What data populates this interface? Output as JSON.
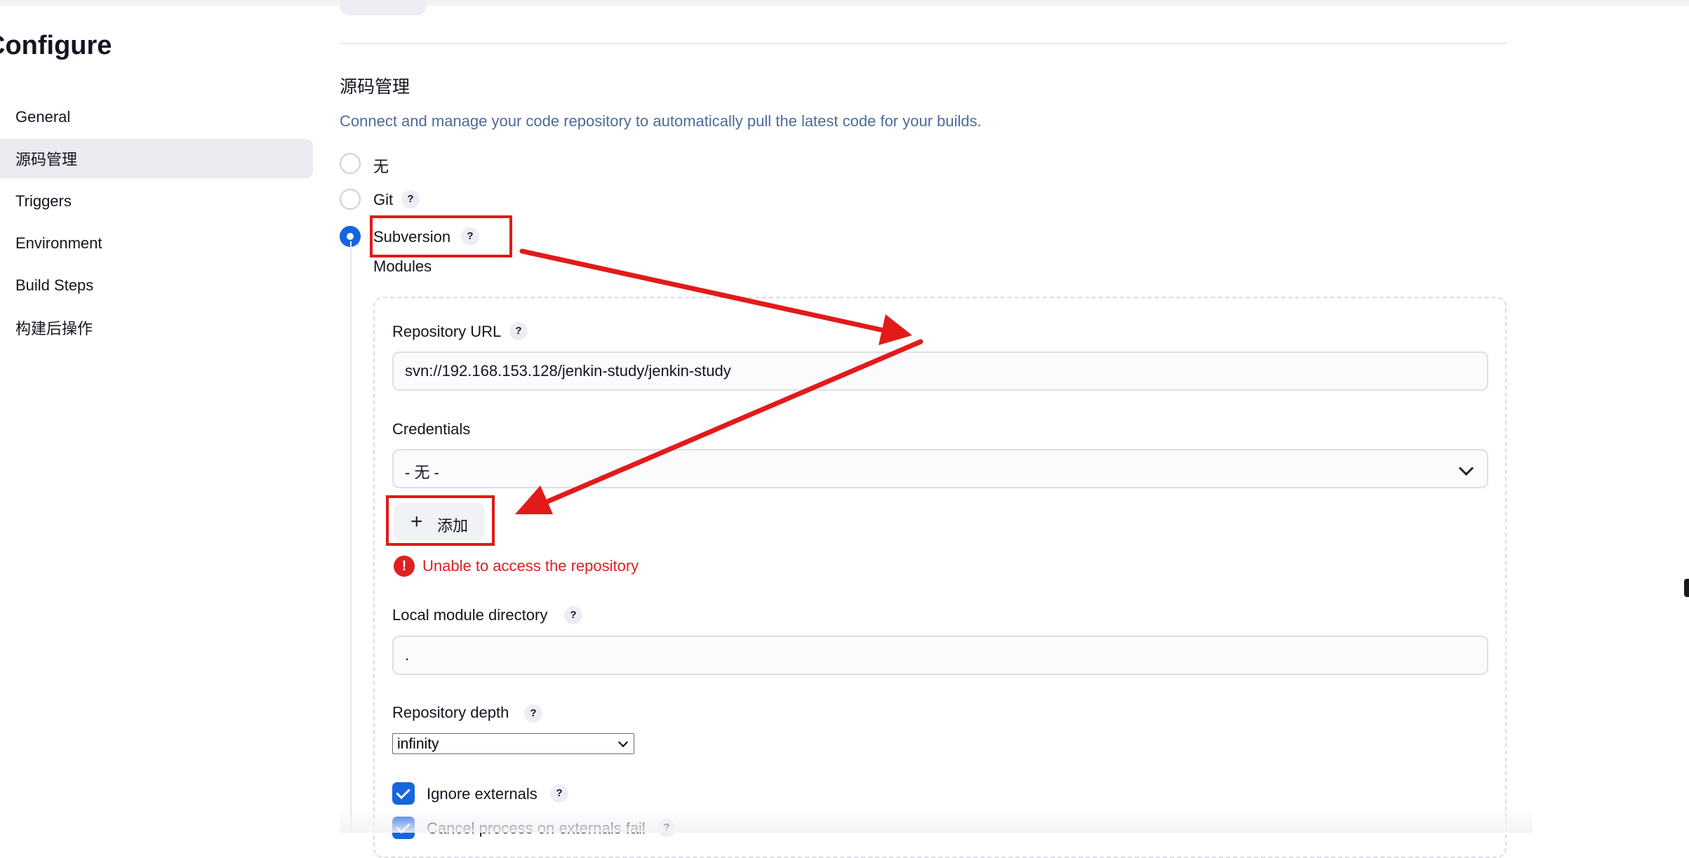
{
  "page": {
    "title": "Configure"
  },
  "sidebar": {
    "items": [
      {
        "label": "General",
        "active": false
      },
      {
        "label": "源码管理",
        "active": true
      },
      {
        "label": "Triggers",
        "active": false
      },
      {
        "label": "Environment",
        "active": false
      },
      {
        "label": "Build Steps",
        "active": false
      },
      {
        "label": "构建后操作",
        "active": false
      }
    ]
  },
  "scm": {
    "title": "源码管理",
    "description": "Connect and manage your code repository to automatically pull the latest code for your builds.",
    "options": [
      {
        "label": "无",
        "selected": false
      },
      {
        "label": "Git",
        "selected": false
      },
      {
        "label": "Subversion",
        "selected": true
      }
    ],
    "help_glyph": "?",
    "modules_label": "Modules",
    "repository_url": {
      "label": "Repository URL",
      "value": "svn://192.168.153.128/jenkin-study/jenkin-study"
    },
    "credentials": {
      "label": "Credentials",
      "value": "- 无 -"
    },
    "add_button": {
      "icon": "+",
      "label": "添加"
    },
    "error": {
      "icon": "!",
      "message": "Unable to access the repository"
    },
    "local_module_directory": {
      "label": "Local module directory",
      "value": "."
    },
    "repository_depth": {
      "label": "Repository depth",
      "value": "infinity"
    },
    "checkboxes": [
      {
        "label": "Ignore externals",
        "checked": true
      },
      {
        "label": "Cancel process on externals fail",
        "checked": true
      }
    ]
  },
  "colors": {
    "accent": "#1565e0",
    "error": "#e01f1f",
    "annotation": "#e21a1a",
    "description": "#4e6b98"
  }
}
